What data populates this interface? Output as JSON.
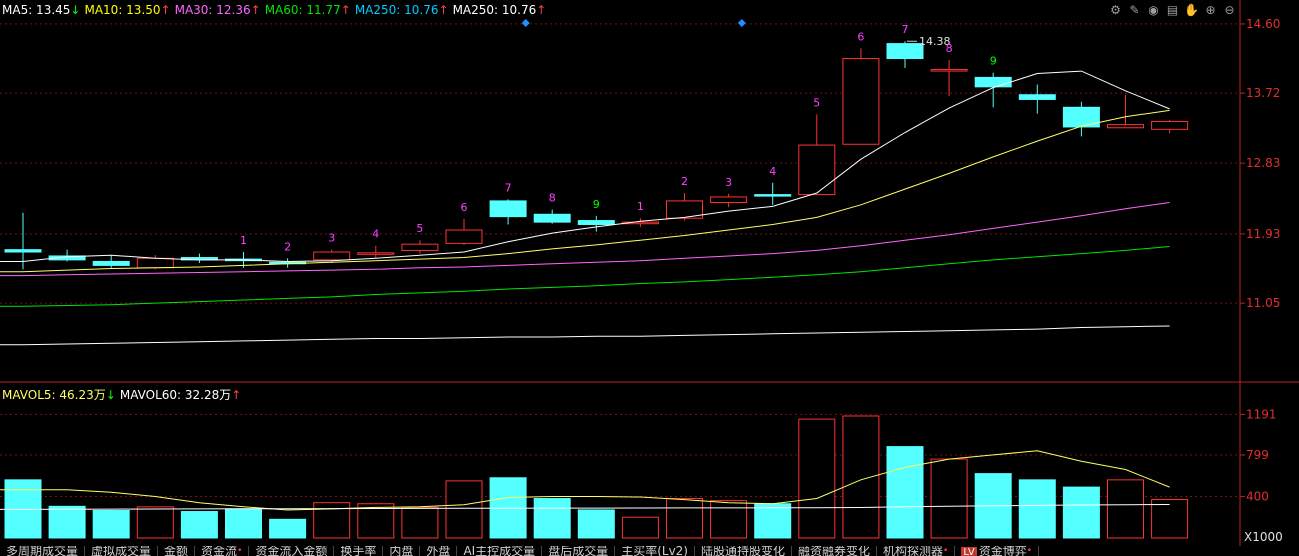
{
  "legend": {
    "ma": [
      {
        "label": "MA5: 13.45",
        "arrow": "↓",
        "color": "#ffffff"
      },
      {
        "label": "MA10: 13.50",
        "arrow": "↑",
        "color": "#ffff00"
      },
      {
        "label": "MA30: 12.36",
        "arrow": "↑",
        "color": "#ff66ff"
      },
      {
        "label": "MA60: 11.77",
        "arrow": "↑",
        "color": "#00e600"
      },
      {
        "label": "MA250: 10.76",
        "arrow": "↑",
        "color": "#00ccff"
      },
      {
        "label": "MA250: 10.76",
        "arrow": "↑",
        "color": "#ffffff"
      }
    ],
    "vol": [
      {
        "label": "MAVOL5: 46.23万",
        "arrow": "↓",
        "color": "#ffff66"
      },
      {
        "label": "MAVOL60: 32.28万",
        "arrow": "↑",
        "color": "#ffffff"
      }
    ]
  },
  "toolbar": {
    "icons": [
      {
        "name": "settings-icon",
        "glyph": "⚙"
      },
      {
        "name": "dropper-icon",
        "glyph": "✎"
      },
      {
        "name": "eye-icon",
        "glyph": "◉"
      },
      {
        "name": "eraser-icon",
        "glyph": "▤"
      },
      {
        "name": "hand-icon",
        "glyph": "✋"
      },
      {
        "name": "zoom-in-icon",
        "glyph": "⊕"
      },
      {
        "name": "zoom-out-icon",
        "glyph": "⊖"
      }
    ]
  },
  "tabs": [
    {
      "label": "多周期成交量",
      "badge": "",
      "dot": false
    },
    {
      "label": "虚拟成交量",
      "badge": "",
      "dot": false
    },
    {
      "label": "金额",
      "badge": "",
      "dot": false
    },
    {
      "label": "资金流",
      "badge": "",
      "dot": true
    },
    {
      "label": "资金流入金额",
      "badge": "",
      "dot": false
    },
    {
      "label": "换手率",
      "badge": "",
      "dot": false
    },
    {
      "label": "内盘",
      "badge": "",
      "dot": false
    },
    {
      "label": "外盘",
      "badge": "",
      "dot": false
    },
    {
      "label": "AI主控成交量",
      "badge": "",
      "dot": false
    },
    {
      "label": "盘后成交量",
      "badge": "",
      "dot": false
    },
    {
      "label": "主买率(Lv2)",
      "badge": "",
      "dot": false
    },
    {
      "label": "陆股通持股变化",
      "badge": "",
      "dot": false
    },
    {
      "label": "融资融券变化",
      "badge": "",
      "dot": false
    },
    {
      "label": "机构探测器",
      "badge": "",
      "dot": true
    },
    {
      "label": "资金博弈",
      "badge": "LV",
      "dot": true
    }
  ],
  "vol_unit": "X1000",
  "chart_data": {
    "type": "candlestick",
    "price_axis": {
      "ticks": [
        14.6,
        13.72,
        12.83,
        11.93,
        11.05
      ],
      "ylim": [
        10.2,
        14.65
      ]
    },
    "volume_axis": {
      "ticks": [
        1191,
        799,
        400
      ],
      "ylim": [
        0,
        1300
      ]
    },
    "candles": [
      {
        "o": 11.7,
        "c": 11.73,
        "h": 12.2,
        "l": 11.48,
        "vol": 560,
        "up": false,
        "label": ""
      },
      {
        "o": 11.65,
        "c": 11.6,
        "h": 11.73,
        "l": 11.58,
        "vol": 305,
        "up": false,
        "label": ""
      },
      {
        "o": 11.58,
        "c": 11.53,
        "h": 11.65,
        "l": 11.5,
        "vol": 265,
        "up": false,
        "label": ""
      },
      {
        "o": 11.5,
        "c": 11.62,
        "h": 11.66,
        "l": 11.48,
        "vol": 300,
        "up": true,
        "label": ""
      },
      {
        "o": 11.63,
        "c": 11.6,
        "h": 11.68,
        "l": 11.56,
        "vol": 255,
        "up": false,
        "label": ""
      },
      {
        "o": 11.61,
        "c": 11.59,
        "h": 11.7,
        "l": 11.5,
        "vol": 280,
        "up": false,
        "label": "1",
        "labelColor": "#ff40ff"
      },
      {
        "o": 11.57,
        "c": 11.56,
        "h": 11.62,
        "l": 11.5,
        "vol": 180,
        "up": false,
        "label": "2",
        "labelColor": "#ff40ff"
      },
      {
        "o": 11.6,
        "c": 11.7,
        "h": 11.73,
        "l": 11.56,
        "vol": 340,
        "up": true,
        "label": "3",
        "labelColor": "#ff40ff"
      },
      {
        "o": 11.68,
        "c": 11.69,
        "h": 11.78,
        "l": 11.62,
        "vol": 330,
        "up": true,
        "label": "4",
        "labelColor": "#ff40ff"
      },
      {
        "o": 11.72,
        "c": 11.8,
        "h": 11.85,
        "l": 11.68,
        "vol": 295,
        "up": true,
        "label": "5",
        "labelColor": "#ff40ff"
      },
      {
        "o": 11.81,
        "c": 11.98,
        "h": 12.12,
        "l": 11.79,
        "vol": 550,
        "up": true,
        "label": "6",
        "labelColor": "#ff40ff"
      },
      {
        "o": 12.35,
        "c": 12.15,
        "h": 12.37,
        "l": 12.05,
        "vol": 580,
        "up": false,
        "label": "7",
        "labelColor": "#ff40ff"
      },
      {
        "o": 12.18,
        "c": 12.08,
        "h": 12.24,
        "l": 12.06,
        "vol": 380,
        "up": false,
        "label": "8",
        "labelColor": "#ff40ff"
      },
      {
        "o": 12.1,
        "c": 12.05,
        "h": 12.16,
        "l": 11.96,
        "vol": 270,
        "up": false,
        "label": "9",
        "labelColor": "#00ff00"
      },
      {
        "o": 12.06,
        "c": 12.08,
        "h": 12.13,
        "l": 12.02,
        "vol": 200,
        "up": true,
        "label": "1",
        "labelColor": "#ff40ff"
      },
      {
        "o": 12.13,
        "c": 12.35,
        "h": 12.45,
        "l": 12.1,
        "vol": 380,
        "up": true,
        "label": "2",
        "labelColor": "#ff40ff"
      },
      {
        "o": 12.33,
        "c": 12.4,
        "h": 12.44,
        "l": 12.27,
        "vol": 360,
        "up": true,
        "label": "3",
        "labelColor": "#ff40ff"
      },
      {
        "o": 12.43,
        "c": 12.42,
        "h": 12.58,
        "l": 12.3,
        "vol": 330,
        "up": false,
        "label": "4",
        "labelColor": "#ff40ff"
      },
      {
        "o": 12.43,
        "c": 13.06,
        "h": 13.45,
        "l": 12.43,
        "vol": 1145,
        "up": true,
        "label": "5",
        "labelColor": "#ff40ff"
      },
      {
        "o": 13.07,
        "c": 14.16,
        "h": 14.29,
        "l": 13.07,
        "vol": 1175,
        "up": true,
        "label": "6",
        "labelColor": "#ff40ff"
      },
      {
        "o": 14.35,
        "c": 14.16,
        "h": 14.38,
        "l": 14.04,
        "vol": 880,
        "up": false,
        "label": "7",
        "labelColor": "#ff40ff",
        "annotation": "14.38"
      },
      {
        "o": 14.02,
        "c": 14.02,
        "h": 14.14,
        "l": 13.68,
        "vol": 760,
        "up": true,
        "label": "8",
        "labelColor": "#ff40ff"
      },
      {
        "o": 13.92,
        "c": 13.8,
        "h": 13.98,
        "l": 13.54,
        "vol": 620,
        "up": false,
        "label": "9",
        "labelColor": "#00ff00"
      },
      {
        "o": 13.7,
        "c": 13.64,
        "h": 13.83,
        "l": 13.46,
        "vol": 560,
        "up": false,
        "label": "",
        "labelColor": "#ff40ff"
      },
      {
        "o": 13.54,
        "c": 13.29,
        "h": 13.61,
        "l": 13.17,
        "vol": 490,
        "up": false,
        "label": "",
        "labelColor": "#ff40ff"
      },
      {
        "o": 13.28,
        "c": 13.32,
        "h": 13.7,
        "l": 13.28,
        "vol": 560,
        "up": true,
        "label": "",
        "labelColor": "#ff40ff"
      },
      {
        "o": 13.26,
        "c": 13.36,
        "h": 13.38,
        "l": 13.21,
        "vol": 370,
        "up": true,
        "label": "",
        "labelColor": "#ff40ff"
      }
    ],
    "lines": [
      {
        "name": "MA5",
        "color": "#ffffff",
        "values": [
          11.58,
          11.64,
          11.66,
          11.62,
          11.6,
          11.6,
          11.58,
          11.59,
          11.62,
          11.66,
          11.7,
          11.83,
          11.94,
          12.02,
          12.09,
          12.14,
          12.22,
          12.28,
          12.45,
          12.88,
          13.22,
          13.53,
          13.79,
          13.97,
          14.0,
          13.75,
          13.52
        ]
      },
      {
        "name": "MA10",
        "color": "#ffff66",
        "values": [
          11.45,
          11.47,
          11.49,
          11.5,
          11.51,
          11.53,
          11.55,
          11.57,
          11.59,
          11.61,
          11.63,
          11.68,
          11.74,
          11.79,
          11.85,
          11.91,
          11.98,
          12.05,
          12.14,
          12.3,
          12.5,
          12.7,
          12.91,
          13.11,
          13.3,
          13.42,
          13.5
        ]
      },
      {
        "name": "MA30",
        "color": "#ff66ff",
        "values": [
          11.4,
          11.41,
          11.42,
          11.43,
          11.44,
          11.45,
          11.46,
          11.47,
          11.48,
          11.5,
          11.51,
          11.53,
          11.55,
          11.57,
          11.59,
          11.62,
          11.65,
          11.68,
          11.72,
          11.78,
          11.85,
          11.92,
          12.0,
          12.08,
          12.16,
          12.25,
          12.33
        ]
      },
      {
        "name": "MA60",
        "color": "#00e600",
        "values": [
          11.01,
          11.02,
          11.03,
          11.05,
          11.07,
          11.09,
          11.11,
          11.13,
          11.16,
          11.18,
          11.2,
          11.23,
          11.25,
          11.27,
          11.3,
          11.32,
          11.35,
          11.38,
          11.41,
          11.45,
          11.5,
          11.55,
          11.6,
          11.64,
          11.68,
          11.72,
          11.77
        ]
      },
      {
        "name": "MA250",
        "color": "#ffffff",
        "values": [
          10.52,
          10.53,
          10.54,
          10.55,
          10.56,
          10.57,
          10.58,
          10.59,
          10.6,
          10.6,
          10.61,
          10.62,
          10.62,
          10.63,
          10.63,
          10.64,
          10.65,
          10.66,
          10.67,
          10.68,
          10.69,
          10.7,
          10.71,
          10.72,
          10.74,
          10.75,
          10.76
        ]
      }
    ],
    "vol_lines": [
      {
        "name": "MAVOL5",
        "color": "#ffff66",
        "values": [
          465,
          465,
          440,
          400,
          340,
          300,
          270,
          280,
          295,
          300,
          320,
          390,
          400,
          400,
          395,
          370,
          340,
          330,
          380,
          560,
          680,
          760,
          800,
          840,
          740,
          660,
          490
        ]
      },
      {
        "name": "MAVOL60",
        "color": "#ffffff",
        "values": [
          275,
          277,
          278,
          279,
          280,
          281,
          282,
          283,
          284,
          285,
          286,
          287,
          288,
          288,
          289,
          290,
          290,
          291,
          292,
          294,
          300,
          305,
          310,
          314,
          318,
          320,
          323
        ]
      }
    ],
    "markers": [
      {
        "type": "diamond",
        "index": 11.4,
        "color": "#1e90ff"
      },
      {
        "type": "diamond",
        "index": 16.3,
        "color": "#1e90ff"
      }
    ]
  }
}
